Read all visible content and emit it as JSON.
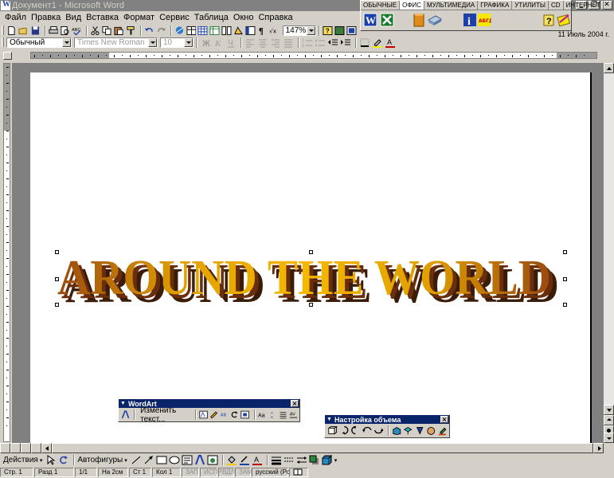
{
  "window": {
    "title": "Документ1 - Microsoft Word",
    "controls": [
      "minimize",
      "restore",
      "close"
    ]
  },
  "menu": {
    "items": [
      "Файл",
      "Правка",
      "Вид",
      "Вставка",
      "Формат",
      "Сервис",
      "Таблица",
      "Окно",
      "Справка"
    ]
  },
  "standard_toolbar": {
    "zoom": "147%"
  },
  "formatting_toolbar": {
    "style": "Обычный",
    "font": "Times New Roman",
    "size": "10"
  },
  "office_bar": {
    "tabs": [
      "ОБЫЧНЫЕ",
      "ОФИС",
      "МУЛЬТИМЕДИА",
      "ГРАФИКА",
      "УТИЛИТЫ",
      "CD",
      "ИНТЕРНЕТ"
    ],
    "active_tab": "ОФИС",
    "date": "11 Июль 2004 г."
  },
  "document": {
    "wordart_text": "AROUND THE WORLD",
    "colors": {
      "wordart_face_gold": "#f5b800",
      "wordart_face_brown": "#9a4a10",
      "wordart_extrusion": "#3a1c08"
    }
  },
  "wordart_toolbar": {
    "title": "WordArt",
    "edit_text_button": "Изменить текст..."
  },
  "3d_toolbar": {
    "title": "Настройка объема"
  },
  "drawing_toolbar": {
    "actions": "Действия",
    "autoshapes": "Автофигуры"
  },
  "status_bar": {
    "page": "Стр. 1",
    "section": "Разд 1",
    "page_of": "1/1",
    "at": "На 2см",
    "line": "Ст 1",
    "column": "Кол 1",
    "rec": "ЗАП",
    "trk": "ИСПР",
    "ext": "ВДЛ",
    "ovr": "ЗАМ",
    "language": "русский (Ро"
  }
}
